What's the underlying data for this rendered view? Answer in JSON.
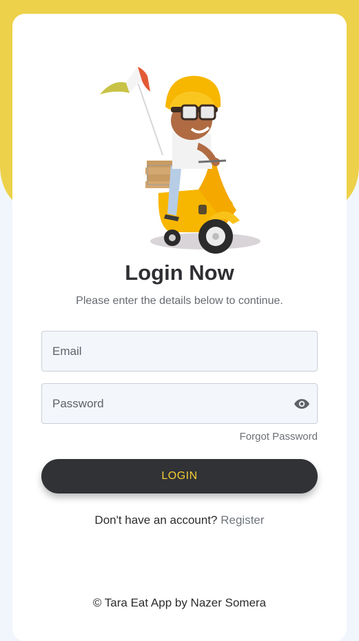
{
  "header": {
    "title": "Login Now",
    "subtitle": "Please enter the details below to continue."
  },
  "form": {
    "email_placeholder": "Email",
    "password_placeholder": "Password",
    "forgot_label": "Forgot Password",
    "login_label": "LOGIN"
  },
  "register": {
    "prompt": "Don't have an account?",
    "link": "Register"
  },
  "footer": {
    "text": "© Tara Eat App by Nazer Somera"
  },
  "colors": {
    "accent_yellow": "#edd14a",
    "button_dark": "#313235",
    "button_text": "#f4cd35"
  },
  "icons": {
    "password_toggle": "eye-icon"
  }
}
